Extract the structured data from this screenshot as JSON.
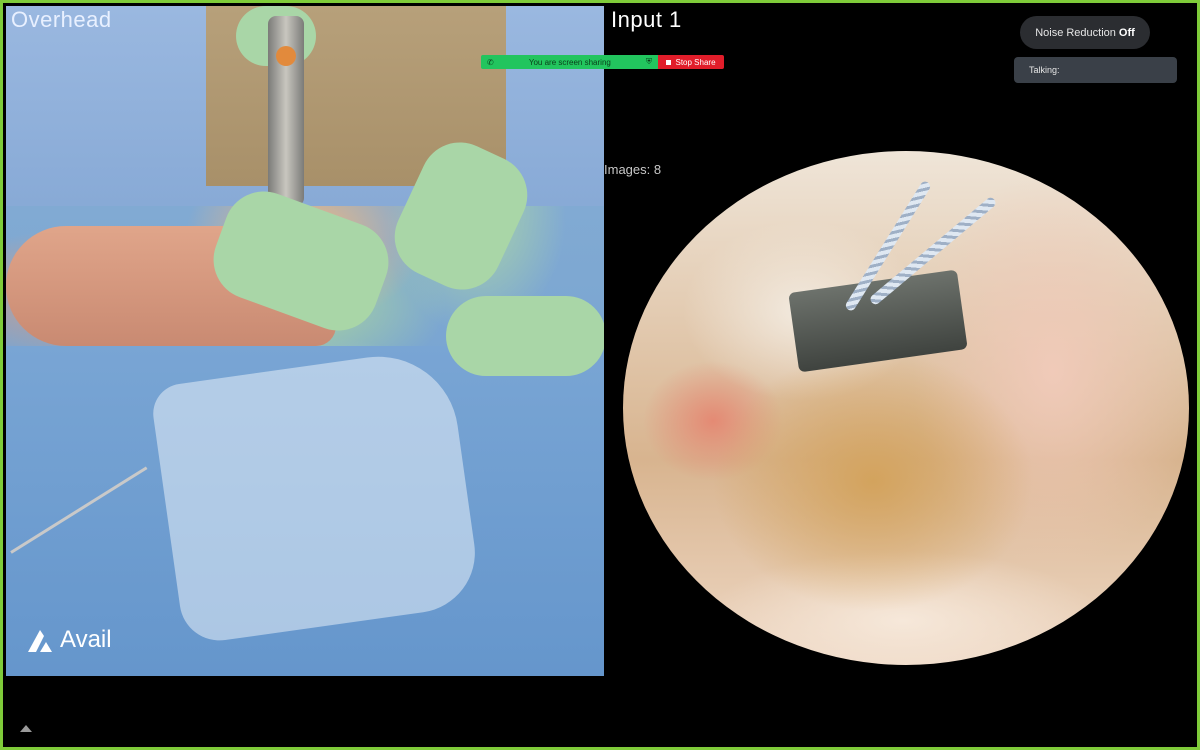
{
  "panels": {
    "left_title": "Overhead",
    "right_title": "Input 1",
    "images_count": "Images: 8"
  },
  "branding": {
    "logo_text": "Avail"
  },
  "share_bar": {
    "status_text": "You are screen sharing",
    "stop_label": "Stop Share"
  },
  "controls": {
    "noise_label": "Noise Reduction",
    "noise_state": "Off",
    "talking_label": "Talking:"
  },
  "colors": {
    "frame_border": "#7fcc3a",
    "share_green": "#22c55e",
    "stop_red": "#e11d2a"
  }
}
